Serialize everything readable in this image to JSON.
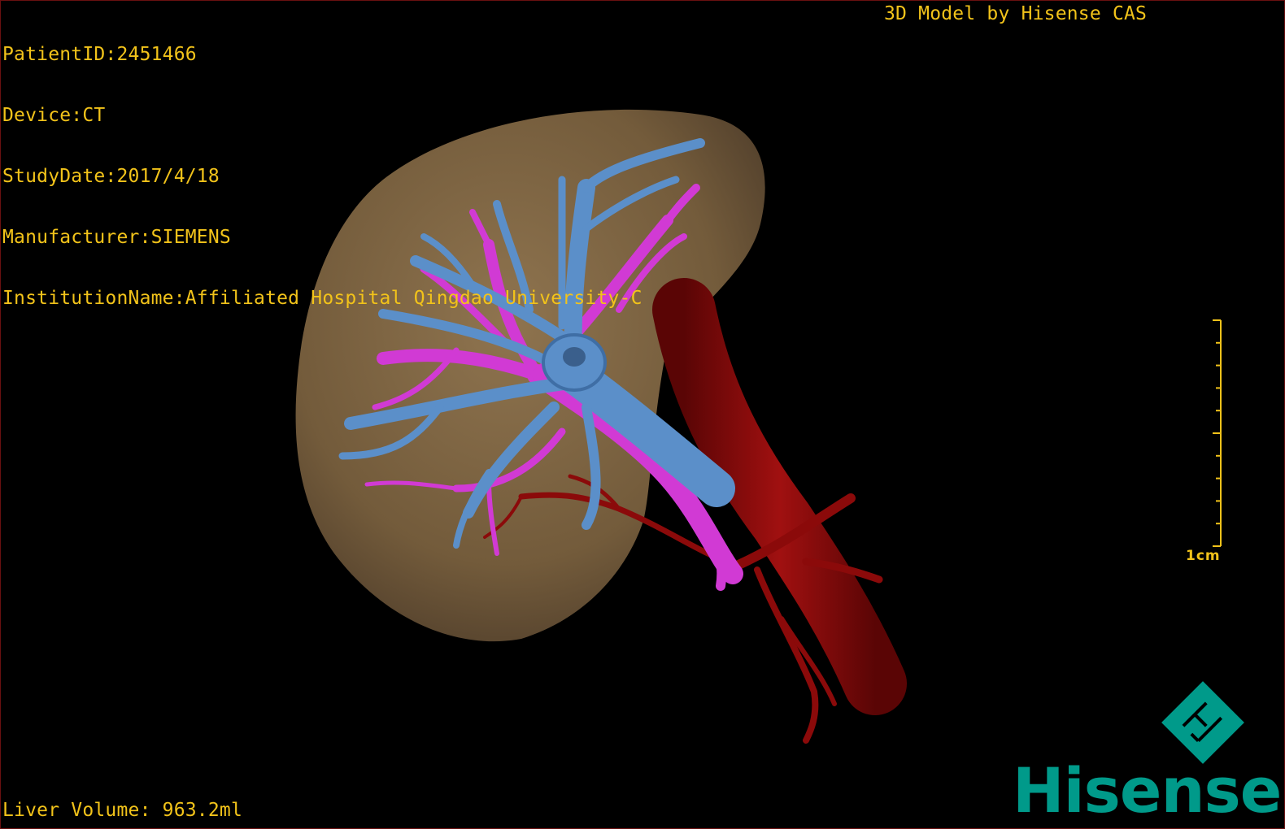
{
  "overlay": {
    "patient_id": "PatientID:2451466",
    "device": "Device:CT",
    "study_date": "StudyDate:2017/4/18",
    "manufacturer": "Manufacturer:SIEMENS",
    "institution": "InstitutionName:Affiliated Hospital Qingdao University-C",
    "model_credit": "3D Model by Hisense CAS",
    "liver_volume": "Liver Volume: 963.2ml"
  },
  "scale": {
    "label": "1cm"
  },
  "brand": {
    "wordmark": "Hisense",
    "logo_icon": "hisense-diamond-logo-icon"
  },
  "colors": {
    "overlay_text": "#f2c31a",
    "liver": "#8a6d47",
    "hepatic_veins": "#5b8fc9",
    "portal_vein": "#d13ad4",
    "ivc_arteries": "#8b0a0a",
    "brand": "#009a8a"
  }
}
